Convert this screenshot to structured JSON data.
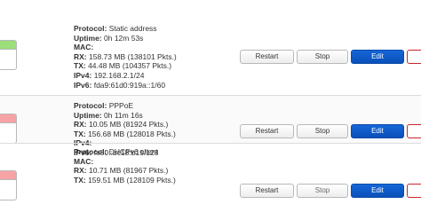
{
  "interfaces": [
    {
      "badge_color": "#9bde7a",
      "badge_fragment": "θ)",
      "protocol_label": "Protocol:",
      "protocol_value": "Static address",
      "lines": [
        {
          "label": "Uptime:",
          "value": "0h 12m 53s"
        },
        {
          "label": "MAC:",
          "value": ""
        },
        {
          "label": "RX:",
          "value": "158.73 MB (138101 Pkts.)"
        },
        {
          "label": "TX:",
          "value": "44.48 MB (104357 Pkts.)"
        },
        {
          "label": "IPv4:",
          "value": "192.168.2.1/24"
        },
        {
          "label": "IPv6:",
          "value": "fda9:61d0:919a::1/60"
        }
      ],
      "buttons": {
        "restart": "Restart",
        "stop": "Stop",
        "edit": "Edit",
        "delete": ""
      }
    },
    {
      "badge_color": "#f7a3a5",
      "badge_fragment": "an",
      "protocol_label": "Protocol:",
      "protocol_value": "PPPoE",
      "lines": [
        {
          "label": "Uptime:",
          "value": "0h 11m 16s"
        },
        {
          "label": "RX:",
          "value": "10.05 MB (81924 Pkts.)"
        },
        {
          "label": "TX:",
          "value": "156.68 MB (128018 Pkts.)"
        },
        {
          "label": "IPv4:",
          "value": ""
        },
        {
          "label": "IPv6:",
          "value": "fe80::bc18:b19/128"
        }
      ],
      "buttons": {
        "restart": "Restart",
        "stop": "Stop",
        "edit": "Edit",
        "delete": ""
      }
    },
    {
      "badge_color": "#f7a3a5",
      "badge_fragment": "",
      "protocol_label": "Protocol:",
      "protocol_value": "DHCPv6 client",
      "lines": [
        {
          "label": "MAC:",
          "value": ""
        },
        {
          "label": "RX:",
          "value": "10.71 MB (81967 Pkts.)"
        },
        {
          "label": "TX:",
          "value": "159.51 MB (128109 Pkts.)"
        }
      ],
      "buttons": {
        "restart": "Restart",
        "stop": "Stop",
        "edit": "Edit",
        "delete": ""
      }
    }
  ]
}
